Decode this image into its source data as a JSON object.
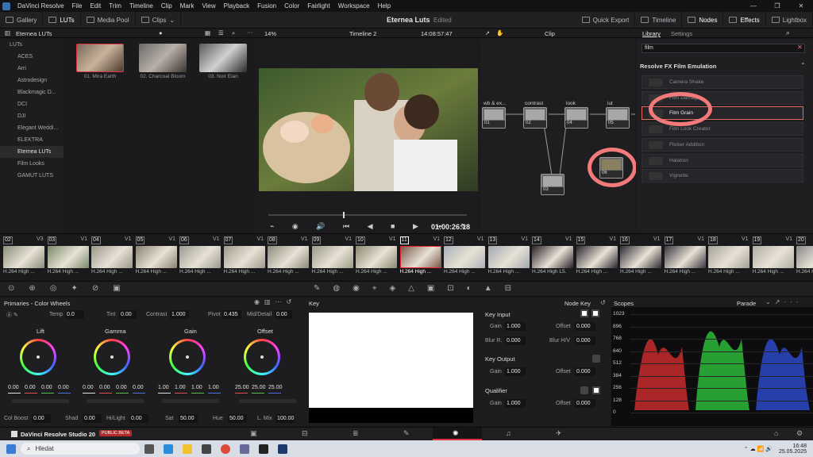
{
  "app": {
    "name": "DaVinci Resolve",
    "menu": [
      "File",
      "Edit",
      "Trim",
      "Timeline",
      "Clip",
      "Mark",
      "View",
      "Playback",
      "Fusion",
      "Color",
      "Fairlight",
      "Workspace",
      "Help"
    ],
    "project_title": "Eterneа Luts",
    "project_status": "Edited"
  },
  "toolbar": {
    "left": [
      "Gallery",
      "LUTs",
      "Media Pool",
      "Clips"
    ],
    "right": [
      "Quick Export",
      "Timeline",
      "Nodes",
      "Effects",
      "Lightbox"
    ]
  },
  "subbar": {
    "lut_folder": "Eterneа LUTs",
    "zoom": "14%",
    "timeline": "Timeline 2",
    "timecode": "14:08:57:47",
    "node_mode": "Clip",
    "tab_library": "Library",
    "tab_settings": "Settings"
  },
  "luts": {
    "tree": [
      "LUTs",
      "ACES",
      "Arri",
      "Astrodesign",
      "Blackmagic D...",
      "DCI",
      "DJI",
      "Elegant Weddi...",
      "ELEKTRA",
      "Eterneа LUTs",
      "Film Looks",
      "GAMUT LUTS"
    ],
    "selected": "Eterneа LUTs",
    "thumbs": [
      "01. Mira Earth",
      "02. Charcoal Bloom",
      "03. Noir Elan"
    ]
  },
  "viewer": {
    "timecode": "01:00:26:18"
  },
  "nodes": [
    {
      "label": "wb & ex...",
      "num": "01"
    },
    {
      "label": "contrast",
      "num": "02"
    },
    {
      "label": "look",
      "num": "04"
    },
    {
      "label": "lut",
      "num": "05"
    },
    {
      "label": "",
      "num": "03"
    },
    {
      "label": "",
      "num": "06"
    }
  ],
  "effects": {
    "search": "film",
    "category": "Resolve FX Film Emulation",
    "items": [
      "Camera Shake",
      "Film Damage",
      "Film Grain",
      "Film Look Creator",
      "Flicker Addition",
      "Halation",
      "Vignette"
    ],
    "selected": "Film Grain",
    "accent_color": "#f27a7a"
  },
  "clips": [
    {
      "num": "02",
      "track": "V3"
    },
    {
      "num": "03",
      "track": "V1"
    },
    {
      "num": "04",
      "track": "V1"
    },
    {
      "num": "05",
      "track": "V1"
    },
    {
      "num": "06",
      "track": "V1"
    },
    {
      "num": "07",
      "track": "V1"
    },
    {
      "num": "08",
      "track": "V1"
    },
    {
      "num": "09",
      "track": "V1"
    },
    {
      "num": "10",
      "track": "V1"
    },
    {
      "num": "11",
      "track": "V1"
    },
    {
      "num": "12",
      "track": "V1"
    },
    {
      "num": "13",
      "track": "V1"
    },
    {
      "num": "14",
      "track": "V1"
    },
    {
      "num": "15",
      "track": "V1"
    },
    {
      "num": "16",
      "track": "V1"
    },
    {
      "num": "17",
      "track": "V1"
    },
    {
      "num": "18",
      "track": "V1"
    },
    {
      "num": "19",
      "track": "V1"
    },
    {
      "num": "20",
      "track": ""
    }
  ],
  "clip_codec": "H.264 High ...",
  "clip_codec_wide": "H.264 High L5.",
  "primaries": {
    "title": "Primaries - Color Wheels",
    "temp_label": "Temp",
    "temp": "0.0",
    "tint_label": "Tint",
    "tint": "0.00",
    "contrast_label": "Contrast",
    "contrast": "1.000",
    "pivot_label": "Pivot",
    "pivot": "0.435",
    "md_label": "Mid/Detail",
    "md": "0.00",
    "wheels": [
      {
        "name": "Lift",
        "vals": [
          "0.00",
          "0.00",
          "0.00",
          "0.00"
        ]
      },
      {
        "name": "Gamma",
        "vals": [
          "0.00",
          "0.00",
          "0.00",
          "0.00"
        ]
      },
      {
        "name": "Gain",
        "vals": [
          "1.00",
          "1.00",
          "1.00",
          "1.00"
        ]
      },
      {
        "name": "Offset",
        "vals": [
          "25.00",
          "25.00",
          "25.00"
        ]
      }
    ],
    "bottom": [
      {
        "label": "Col Boost",
        "val": "0.00"
      },
      {
        "label": "Shad",
        "val": "0.00"
      },
      {
        "label": "Hi/Light",
        "val": "0.00"
      },
      {
        "label": "Sat",
        "val": "50.00"
      },
      {
        "label": "Hue",
        "val": "50.00"
      },
      {
        "label": "L. Mix",
        "val": "100.00"
      }
    ]
  },
  "key": {
    "title": "Key",
    "node_key": "Node Key",
    "key_input": "Key Input",
    "key_output": "Key Output",
    "qualifier": "Qualifier",
    "gain": "Gain",
    "offset": "Offset",
    "blur_r": "Blur R.",
    "blur_hv": "Blur H/V",
    "g1": "1.000",
    "o1": "0.000",
    "br": "0.000",
    "bhv": "0.000",
    "g2": "1.000",
    "o2": "0.000",
    "g3": "1.000",
    "o3": "0.000"
  },
  "scopes": {
    "title": "Scopes",
    "mode": "Parade",
    "scale": [
      "1023",
      "896",
      "768",
      "640",
      "512",
      "384",
      "256",
      "128",
      "0"
    ]
  },
  "footer": {
    "brand": "DaVinci Resolve Studio 20",
    "badge": "PUBLIC BETA"
  },
  "taskbar": {
    "search": "Hledat",
    "time": "16:48",
    "date": "25.05.2025"
  }
}
